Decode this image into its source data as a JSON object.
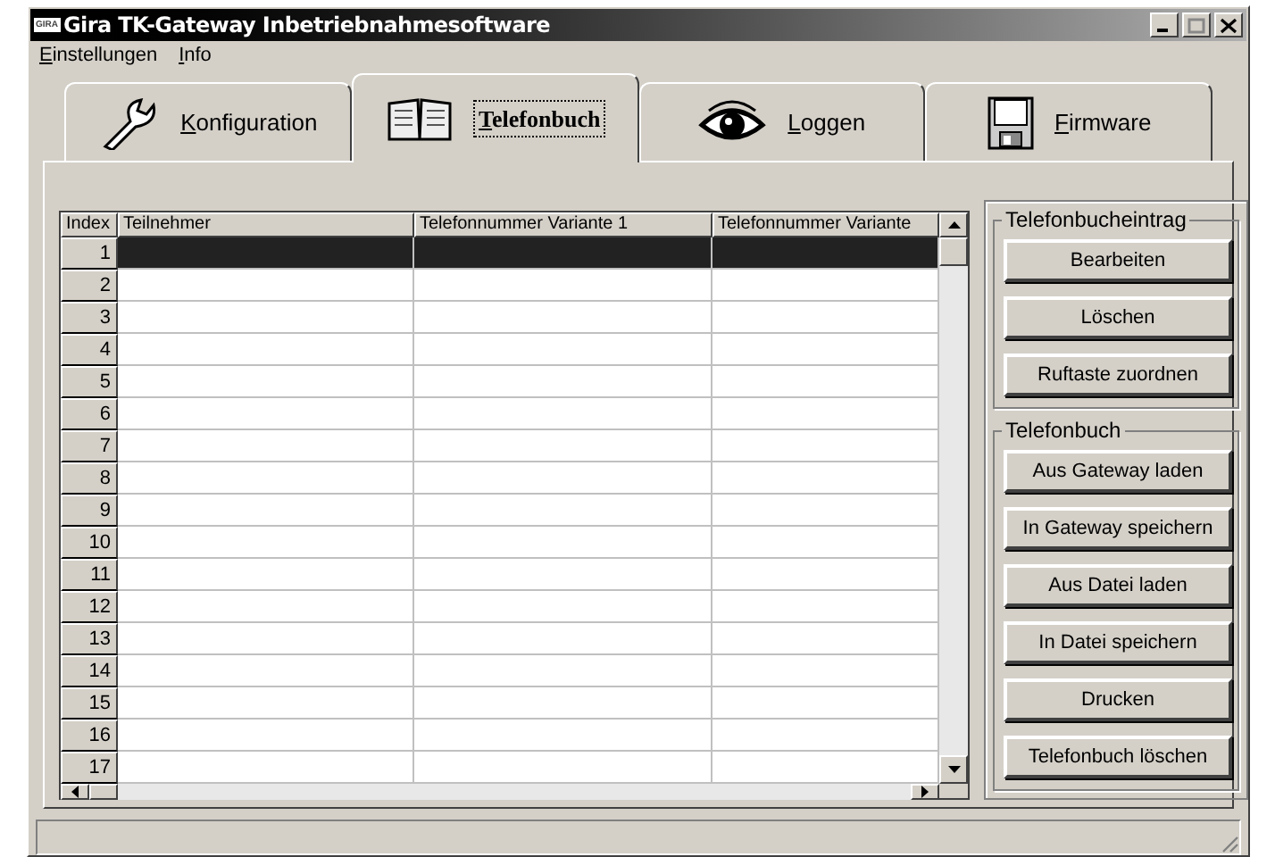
{
  "window": {
    "logo": "GIRA",
    "title": "Gira TK-Gateway Inbetriebnahmesoftware"
  },
  "menu": [
    "Einstellungen",
    "Info"
  ],
  "tabs": [
    {
      "label": "Konfiguration",
      "kind": "wrench",
      "selected": false
    },
    {
      "label": "Telefonbuch",
      "kind": "book",
      "selected": true
    },
    {
      "label": "Loggen",
      "kind": "eye",
      "selected": false
    },
    {
      "label": "Firmware",
      "kind": "floppy",
      "selected": false
    }
  ],
  "table": {
    "columns": [
      "Index",
      "Teilnehmer",
      "Telefonnummer Variante 1",
      "Telefonnummer Variante"
    ],
    "rows": [
      {
        "index": "1",
        "selected": true
      },
      {
        "index": "2",
        "selected": false
      },
      {
        "index": "3",
        "selected": false
      },
      {
        "index": "4",
        "selected": false
      },
      {
        "index": "5",
        "selected": false
      },
      {
        "index": "6",
        "selected": false
      },
      {
        "index": "7",
        "selected": false
      },
      {
        "index": "8",
        "selected": false
      },
      {
        "index": "9",
        "selected": false
      },
      {
        "index": "10",
        "selected": false
      },
      {
        "index": "11",
        "selected": false
      },
      {
        "index": "12",
        "selected": false
      },
      {
        "index": "13",
        "selected": false
      },
      {
        "index": "14",
        "selected": false
      },
      {
        "index": "15",
        "selected": false
      },
      {
        "index": "16",
        "selected": false
      },
      {
        "index": "17",
        "selected": false
      }
    ]
  },
  "groups": [
    {
      "title": "Telefonbucheintrag",
      "buttons": [
        "Bearbeiten",
        "Löschen",
        "Ruftaste zuordnen"
      ]
    },
    {
      "title": "Telefonbuch",
      "buttons": [
        "Aus Gateway laden",
        "In Gateway speichern",
        "Aus Datei laden",
        "In Datei speichern",
        "Drucken",
        "Telefonbuch löschen"
      ]
    }
  ]
}
